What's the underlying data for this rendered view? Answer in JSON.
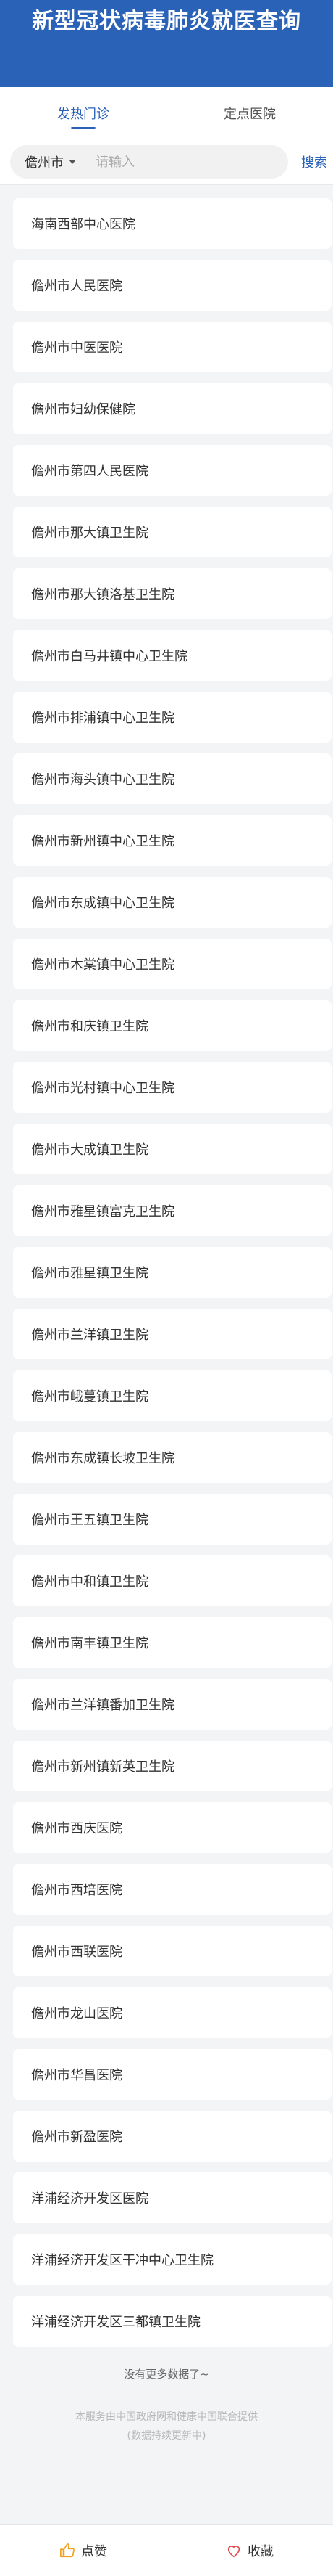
{
  "header": {
    "title": "新型冠状病毒肺炎就医查询"
  },
  "tabs": [
    {
      "label": "发热门诊"
    },
    {
      "label": "定点医院"
    }
  ],
  "search": {
    "city": "儋州市",
    "placeholder": "请输入",
    "button": "搜索"
  },
  "hospitals": [
    "海南西部中心医院",
    "儋州市人民医院",
    "儋州市中医医院",
    "儋州市妇幼保健院",
    "儋州市第四人民医院",
    "儋州市那大镇卫生院",
    "儋州市那大镇洛基卫生院",
    "儋州市白马井镇中心卫生院",
    "儋州市排浦镇中心卫生院",
    "儋州市海头镇中心卫生院",
    "儋州市新州镇中心卫生院",
    "儋州市东成镇中心卫生院",
    "儋州市木棠镇中心卫生院",
    "儋州市和庆镇卫生院",
    "儋州市光村镇中心卫生院",
    "儋州市大成镇卫生院",
    "儋州市雅星镇富克卫生院",
    "儋州市雅星镇卫生院",
    "儋州市兰洋镇卫生院",
    "儋州市峨蔓镇卫生院",
    "儋州市东成镇长坡卫生院",
    "儋州市王五镇卫生院",
    "儋州市中和镇卫生院",
    "儋州市南丰镇卫生院",
    "儋州市兰洋镇番加卫生院",
    "儋州市新州镇新英卫生院",
    "儋州市西庆医院",
    "儋州市西培医院",
    "儋州市西联医院",
    "儋州市龙山医院",
    "儋州市华昌医院",
    "儋州市新盈医院",
    "洋浦经济开发区医院",
    "洋浦经济开发区干冲中心卫生院",
    "洋浦经济开发区三都镇卫生院"
  ],
  "no_more": "没有更多数据了~",
  "footer": {
    "line1": "本服务由中国政府网和健康中国联合提供",
    "line2": "(数据持续更新中)"
  },
  "bottom": {
    "like": "点赞",
    "favorite": "收藏"
  },
  "colors": {
    "brand": "#2a62b8",
    "favorite_icon": "#e5484d",
    "like_icon": "#f0a020"
  }
}
